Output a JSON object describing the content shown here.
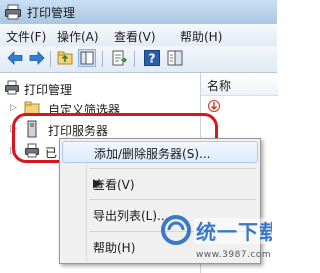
{
  "window": {
    "title": "打印管理"
  },
  "menu": [
    {
      "label": "文件(F)"
    },
    {
      "label": "操作(A)"
    },
    {
      "label": "查看(V)"
    },
    {
      "label": "帮助(H)"
    }
  ],
  "toolbar": {
    "icons": [
      "back-arrow-icon",
      "forward-arrow-icon",
      "up-folder-icon",
      "show-hide-tree-icon",
      "export-list-icon",
      "help-icon",
      "properties-pane-icon"
    ]
  },
  "tree": {
    "root": "打印管理",
    "items": [
      {
        "label": "自定义筛选器"
      },
      {
        "label": "打印服务器"
      },
      {
        "label": "已"
      }
    ]
  },
  "right_pane": {
    "column_header": "名称"
  },
  "context_menu": {
    "items": [
      {
        "label": "添加/删除服务器(S)..."
      },
      {
        "label": "查看(V)"
      },
      {
        "label": "导出列表(L)..."
      },
      {
        "label": "帮助(H)"
      }
    ]
  },
  "colors": {
    "highlight": "#d8161e",
    "accent": "#3a7ac8"
  },
  "watermark": {
    "domain": "www.3987.com"
  }
}
